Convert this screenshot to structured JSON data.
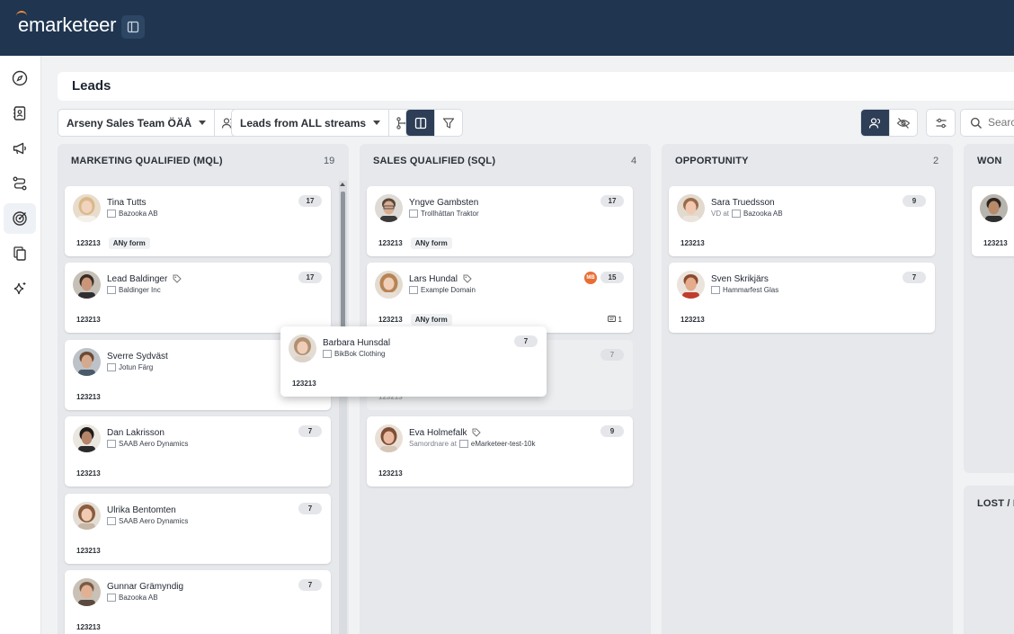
{
  "app": {
    "logo_text": "emarketeer"
  },
  "page": {
    "title": "Leads"
  },
  "toolbar": {
    "team_select": "Arseny Sales Team ÖÄÅ",
    "stream_select": "Leads from ALL streams",
    "search_placeholder": "Search"
  },
  "colors": {
    "topbar": "#1f3550",
    "accent_orange": "#e96e35"
  },
  "columns": [
    {
      "title": "MARKETING QUALIFIED (MQL)",
      "count": "19"
    },
    {
      "title": "SALES QUALIFIED (SQL)",
      "count": "4"
    },
    {
      "title": "OPPORTUNITY",
      "count": "2"
    },
    {
      "title": "WON",
      "count": ""
    },
    {
      "title": "LOST / N",
      "count": ""
    }
  ],
  "mql": [
    {
      "name": "Tina Tutts",
      "company": "Bazooka AB",
      "score": "17",
      "chips": [
        "123213",
        "ANy form"
      ]
    },
    {
      "name": "Lead Baldinger",
      "company": "Baldinger Inc",
      "score": "17",
      "chips": [
        "123213"
      ]
    },
    {
      "name": "Sverre Sydväst",
      "company": "Jotun Färg",
      "score": "",
      "chips": [
        "123213"
      ]
    },
    {
      "name": "Dan Lakrisson",
      "company": "SAAB Aero Dynamics",
      "score": "7",
      "chips": [
        "123213"
      ]
    },
    {
      "name": "Ulrika Bentomten",
      "company": "SAAB Aero Dynamics",
      "score": "7",
      "chips": [
        "123213"
      ]
    },
    {
      "name": "Gunnar Grämyndig",
      "company": "Bazooka AB",
      "score": "7",
      "chips": [
        "123213"
      ]
    }
  ],
  "sql": [
    {
      "name": "Yngve Gambsten",
      "company": "Trollhättan Traktor",
      "score": "17",
      "chips": [
        "123213",
        "ANy form"
      ]
    },
    {
      "name": "Lars Hundal",
      "company": "Example Domain",
      "score": "15",
      "owner": "MB",
      "comments": "1",
      "chips": [
        "123213",
        "ANy form"
      ]
    },
    {
      "ghost_score": "7",
      "chips": [
        "123213"
      ]
    },
    {
      "name": "Eva Holmefalk",
      "role": "Samordnare at",
      "company": "eMarketeer-test-10k",
      "score": "9",
      "chips": [
        "123213"
      ]
    }
  ],
  "opp": [
    {
      "name": "Sara Truedsson",
      "role": "VD at",
      "company": "Bazooka AB",
      "score": "9",
      "chips": [
        "123213"
      ]
    },
    {
      "name": "Sven Skrikjärs",
      "company": "Hammarfest Glas",
      "score": "7",
      "chips": [
        "123213"
      ]
    }
  ],
  "won": [
    {
      "chips": [
        "123213"
      ]
    }
  ],
  "dragging": {
    "name": "Barbara Hunsdal",
    "company": "BikBok Clothing",
    "score": "7",
    "chips": [
      "123213"
    ]
  }
}
